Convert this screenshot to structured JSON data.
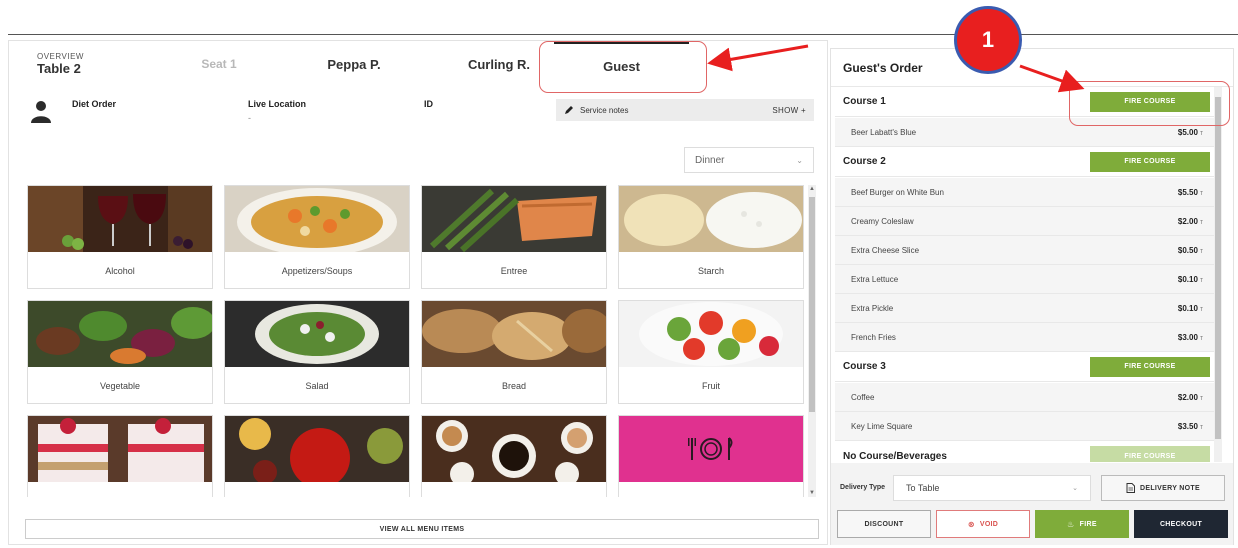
{
  "tabs": {
    "overview_label": "OVERVIEW",
    "overview_table": "Table 2",
    "seat1": "Seat 1",
    "peppa": "Peppa P.",
    "curling": "Curling R.",
    "guest": "Guest"
  },
  "info": {
    "diet_order": "Diet Order",
    "live_location": "Live Location",
    "live_location_value": "-",
    "id": "ID",
    "service_notes": "Service notes",
    "show": "SHOW  +"
  },
  "meal_period": {
    "selected": "Dinner"
  },
  "menu_categories": [
    {
      "label": "Alcohol"
    },
    {
      "label": "Appetizers/Soups"
    },
    {
      "label": "Entree"
    },
    {
      "label": "Starch"
    },
    {
      "label": "Vegetable"
    },
    {
      "label": "Salad"
    },
    {
      "label": "Bread"
    },
    {
      "label": "Fruit"
    },
    {
      "label": ""
    },
    {
      "label": ""
    },
    {
      "label": ""
    },
    {
      "label": ""
    }
  ],
  "view_all": "VIEW ALL MENU ITEMS",
  "order": {
    "title": "Guest's Order",
    "fire_course_label": "FIRE COURSE",
    "courses": [
      {
        "name": "Course 1",
        "items": [
          {
            "name": "Beer Labatt's Blue",
            "price": "$5.00"
          }
        ]
      },
      {
        "name": "Course 2",
        "items": [
          {
            "name": "Beef Burger on White Bun",
            "price": "$5.50"
          },
          {
            "name": "Creamy Coleslaw",
            "price": "$2.00"
          },
          {
            "name": "Extra Cheese Slice",
            "price": "$0.50"
          },
          {
            "name": "Extra Lettuce",
            "price": "$0.10"
          },
          {
            "name": "Extra Pickle",
            "price": "$0.10"
          },
          {
            "name": "French Fries",
            "price": "$3.00"
          }
        ]
      },
      {
        "name": "Course 3",
        "items": [
          {
            "name": "Coffee",
            "price": "$2.00"
          },
          {
            "name": "Key Lime Square",
            "price": "$3.50"
          }
        ]
      },
      {
        "name": "No Course/Beverages",
        "items": []
      }
    ],
    "tax_mark": "T"
  },
  "delivery": {
    "label": "Delivery Type",
    "value": "To Table",
    "note_button": "DELIVERY NOTE"
  },
  "actions": {
    "discount": "DISCOUNT",
    "void": "VOID",
    "fire": "FIRE",
    "checkout": "CHECKOUT"
  },
  "annotation": {
    "step": "1"
  },
  "colors": {
    "accent_green": "#7fac3a",
    "checkout_dark": "#1f2733",
    "void_red": "#d9534f",
    "annotation_red": "#e81f1f",
    "tile_pink": "#e0318f"
  }
}
